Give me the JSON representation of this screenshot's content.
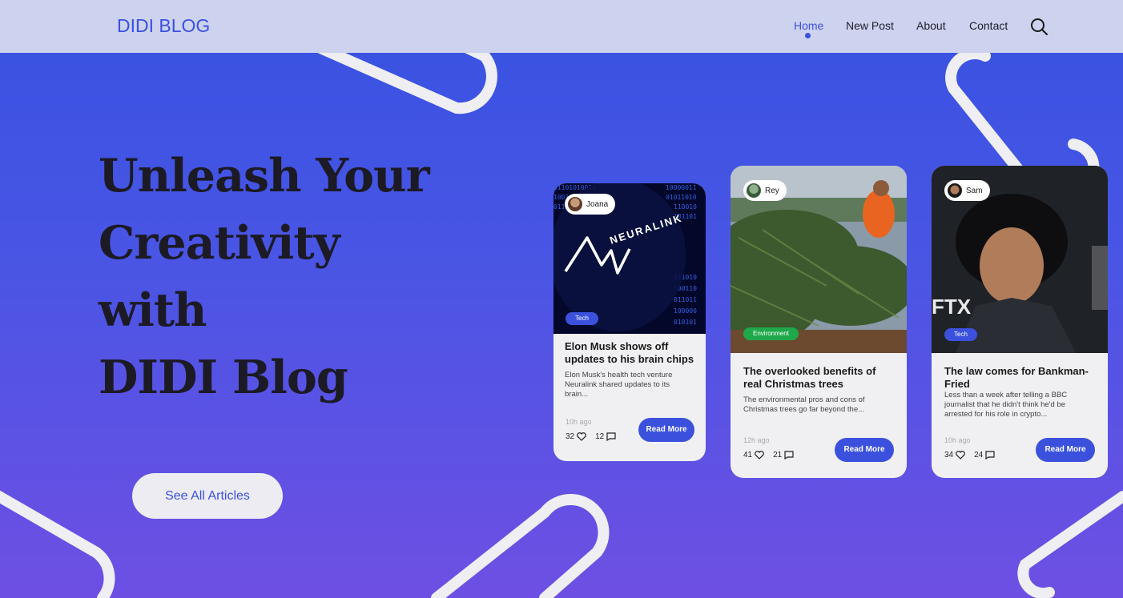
{
  "nav": {
    "logo": "DIDI BLOG",
    "links": [
      "Home",
      "New Post",
      "About",
      "Contact"
    ],
    "active": "Home",
    "search_icon": "search-icon"
  },
  "hero": {
    "title_lines": [
      "Unleash Your",
      "Creativity",
      "with",
      "DIDI Blog"
    ],
    "cta": "See All Articles"
  },
  "cards": [
    {
      "author": "Joana",
      "tag": "Tech",
      "tag_color": "#3b51de",
      "image_text": "NEURALINK",
      "title": "Elon Musk shows off updates to his brain chips",
      "desc": "Elon Musk's health tech venture Neuralink shared updates to its brain...",
      "time": "10h ago",
      "likes": "32",
      "comments": "12",
      "button": "Read More"
    },
    {
      "author": "Rey",
      "tag": "Environment",
      "tag_color": "#1fa84a",
      "title": "The overlooked benefits of real Christmas trees",
      "desc": "The environmental pros and cons of Christmas trees go far beyond the...",
      "time": "12h ago",
      "likes": "41",
      "comments": "21",
      "button": "Read More"
    },
    {
      "author": "Sam",
      "tag": "Tech",
      "tag_color": "#3b51de",
      "image_text": "FTX",
      "title": "The law comes for Bankman-Fried",
      "desc": "Less than a week after telling a BBC journalist that he didn't think he'd be arrested for his role in crypto...",
      "time": "10h ago",
      "likes": "34",
      "comments": "24",
      "button": "Read More"
    }
  ],
  "colors": {
    "accent": "#3b51de",
    "navbar_bg": "#cdd2ee",
    "card_bg": "#f0f0f2"
  }
}
